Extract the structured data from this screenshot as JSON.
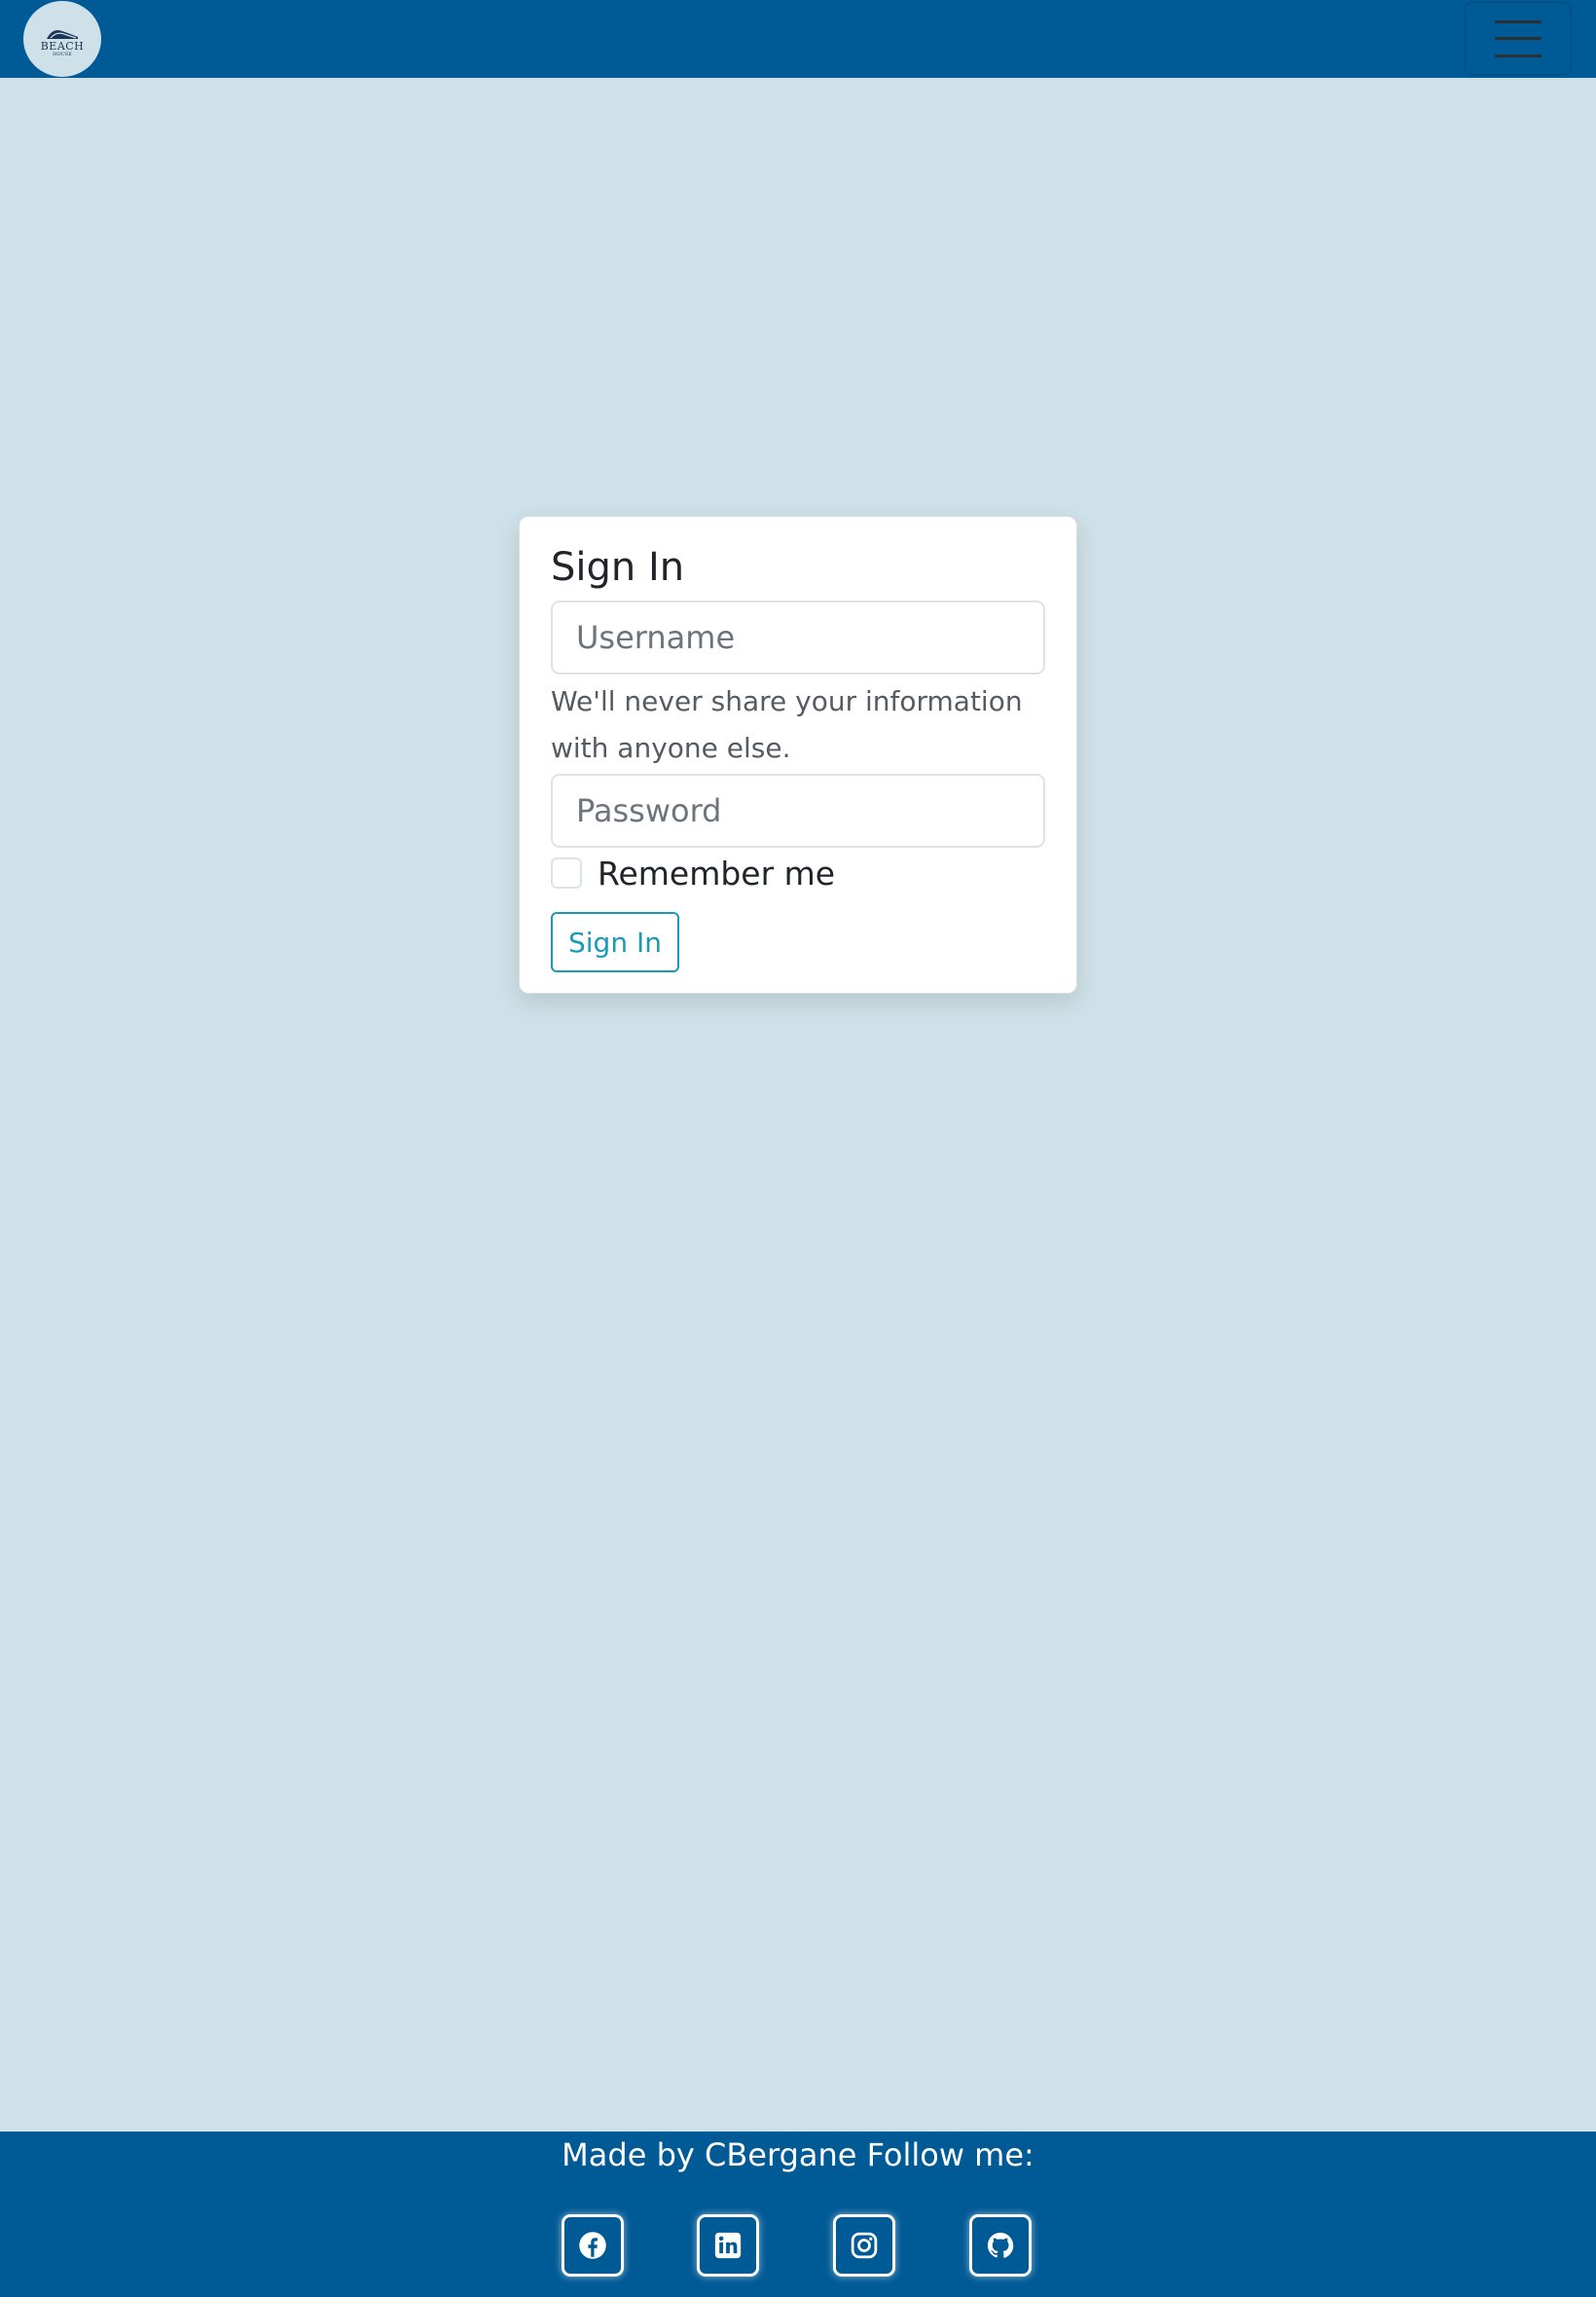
{
  "header": {
    "logo_text": "BEACH",
    "logo_subtext": "HOUSE",
    "menu_icon": "hamburger-menu-icon"
  },
  "signin": {
    "title": "Sign In",
    "username_placeholder": "Username",
    "help_text": "We'll never share your information with anyone else.",
    "password_placeholder": "Password",
    "remember_label": "Remember me",
    "button_label": "Sign In"
  },
  "footer": {
    "text": "Made by CBergane Follow me:",
    "social": [
      {
        "icon": "facebook-icon"
      },
      {
        "icon": "linkedin-icon"
      },
      {
        "icon": "instagram-icon"
      },
      {
        "icon": "github-icon"
      }
    ]
  },
  "colors": {
    "navbar": "#005a96",
    "background": "#cfe1e8",
    "accent": "#1a9ab8"
  }
}
